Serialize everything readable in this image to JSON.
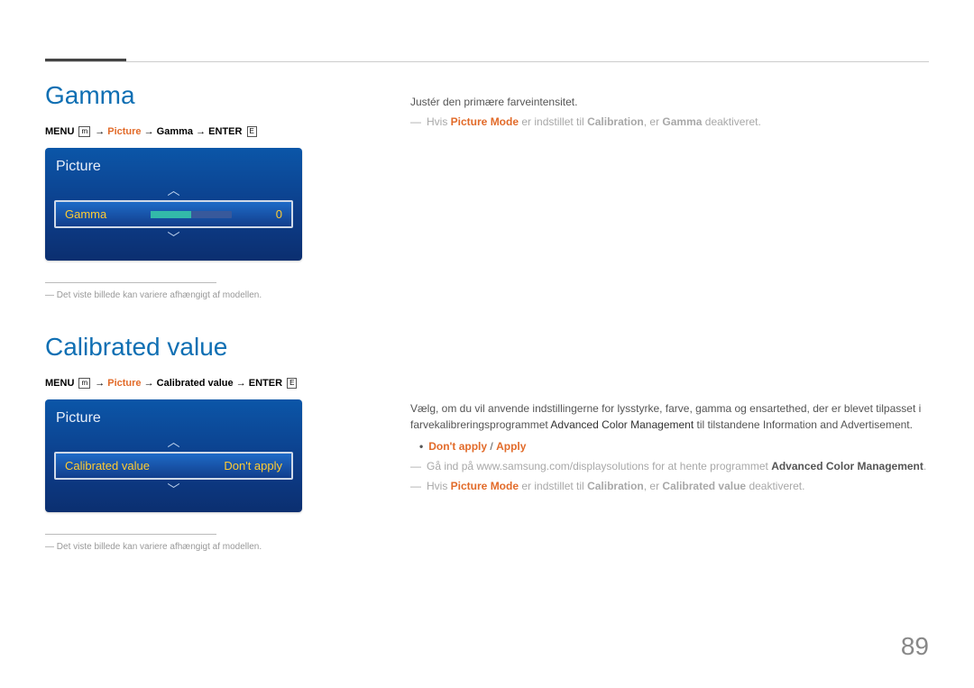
{
  "pageNumber": "89",
  "section1": {
    "title": "Gamma",
    "menu": {
      "menu": "MENU",
      "picture": "Picture",
      "gamma": "Gamma",
      "enter": "ENTER"
    },
    "panel": {
      "title": "Picture",
      "rowLabel": "Gamma",
      "rowValue": "0"
    },
    "footnote": "Det viste billede kan variere afhængigt af modellen.",
    "body": {
      "line1": "Justér den primære farveintensitet.",
      "note": {
        "prefix": "Hvis ",
        "pm": "Picture Mode",
        "mid": " er indstillet til ",
        "cal": "Calibration",
        "mid2": ", er ",
        "g": "Gamma",
        "end": " deaktiveret."
      }
    }
  },
  "section2": {
    "title": "Calibrated value",
    "menu": {
      "menu": "MENU",
      "picture": "Picture",
      "cv": "Calibrated value",
      "enter": "ENTER"
    },
    "panel": {
      "title": "Picture",
      "rowLabel": "Calibrated value",
      "rowValue": "Don't apply"
    },
    "footnote": "Det viste billede kan variere afhængigt af modellen.",
    "body": {
      "line1": "Vælg, om du vil anvende indstillingerne for lysstyrke, farve, gamma og ensartethed, der er blevet tilpasset i farvekalibreringsprogrammet ",
      "acm1": "Advanced Color Management",
      "line1end": " til tilstandene Information and Advertisement.",
      "bullet": {
        "opt1": "Don't apply",
        "sep": " / ",
        "opt2": "Apply"
      },
      "note1": {
        "prefix": "Gå ind på www.samsung.com/displaysolutions for at hente programmet ",
        "acm": "Advanced Color Management",
        "end": "."
      },
      "note2": {
        "prefix": "Hvis ",
        "pm": "Picture Mode",
        "mid": " er indstillet til ",
        "cal": "Calibration",
        "mid2": ", er ",
        "cv": "Calibrated value",
        "end": " deaktiveret."
      }
    }
  }
}
